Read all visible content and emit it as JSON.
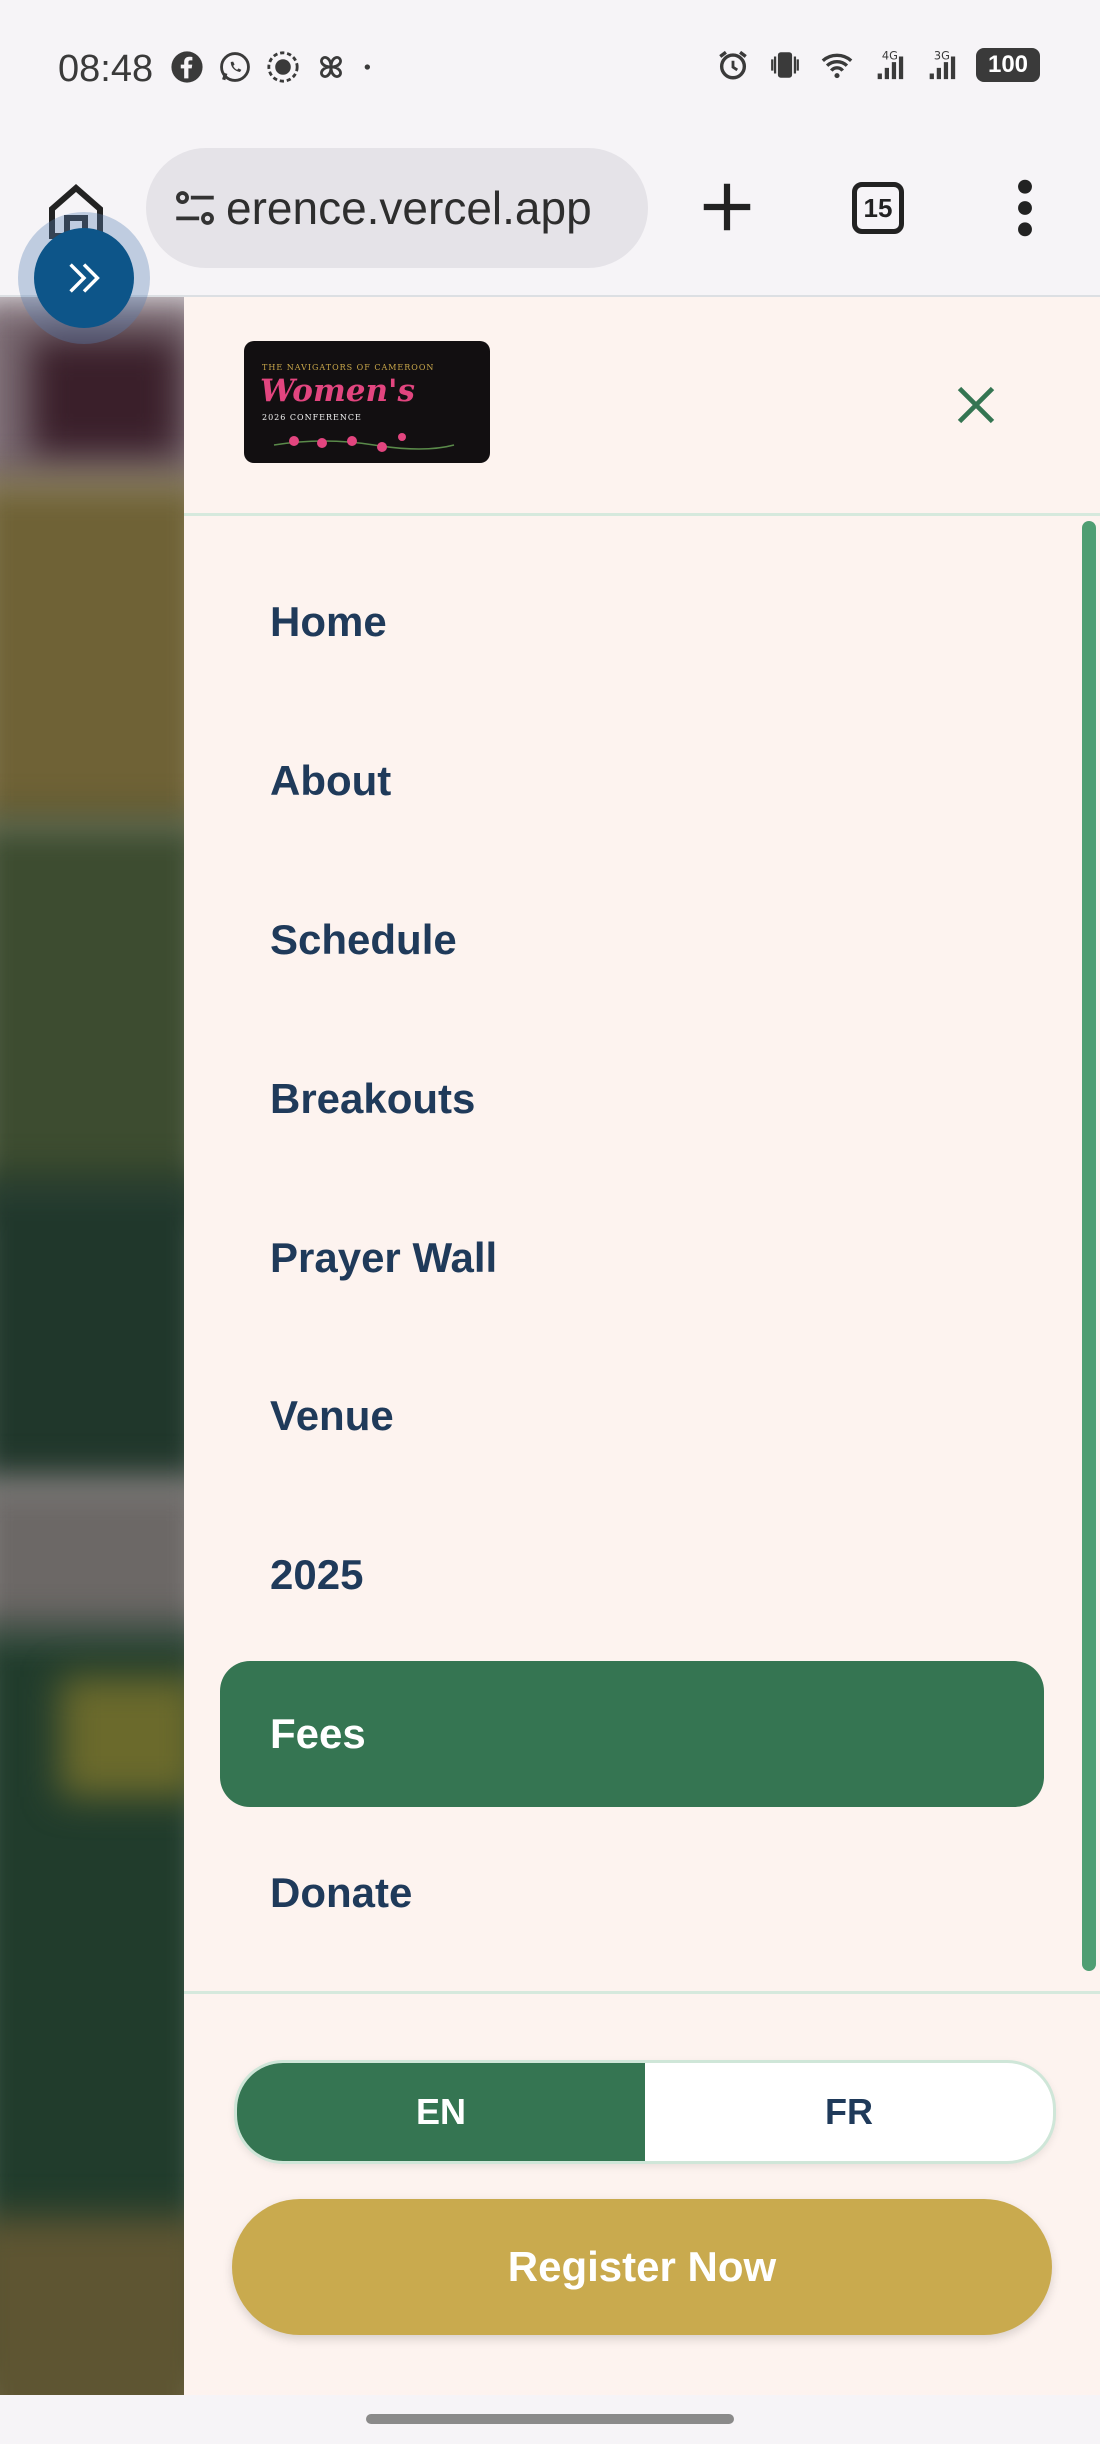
{
  "status_bar": {
    "time": "08:48",
    "battery": "100",
    "signal_1": "4G",
    "signal_2": "3G"
  },
  "browser": {
    "url": "erence.vercel.app",
    "tab_count": "15"
  },
  "drawer": {
    "logo": {
      "top_line": "THE NAVIGATORS OF CAMEROON",
      "main": "Women's",
      "sub_line": "2026 CONFERENCE"
    },
    "nav_items": [
      {
        "label": "Home",
        "active": false
      },
      {
        "label": "About",
        "active": false
      },
      {
        "label": "Schedule",
        "active": false
      },
      {
        "label": "Breakouts",
        "active": false
      },
      {
        "label": "Prayer Wall",
        "active": false
      },
      {
        "label": "Venue",
        "active": false
      },
      {
        "label": "2025",
        "active": false
      },
      {
        "label": "Fees",
        "active": true
      },
      {
        "label": "Donate",
        "active": false
      }
    ],
    "language": {
      "options": [
        "EN",
        "FR"
      ],
      "selected": "EN"
    },
    "register_label": "Register Now"
  },
  "colors": {
    "accent_green": "#357552",
    "gold": "#c9aa4e",
    "nav_text": "#1f3a5a",
    "drawer_bg": "#fdf3ef"
  }
}
